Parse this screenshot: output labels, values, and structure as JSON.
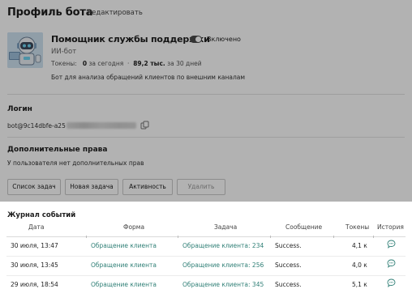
{
  "header": {
    "title": "Профиль бота",
    "edit_label": "Редактировать"
  },
  "bot": {
    "name": "Помощник службы поддержки",
    "toggle_label": "Включено",
    "type": "ИИ-бот",
    "tokens_label": "Токены:",
    "tokens_today_value": "0",
    "tokens_today_label": "за сегодня",
    "tokens_30_value": "89,2 тыс.",
    "tokens_30_label": "за 30 дней",
    "description": "Бот для анализа обращений клиентов по внешним каналам"
  },
  "login": {
    "title": "Логин",
    "value_prefix": "bot@9c14dbfe-a25"
  },
  "rights": {
    "title": "Дополнительные права",
    "text": "У пользователя нет дополнительных прав"
  },
  "actions": {
    "tasks_list": "Список задач",
    "new_task": "Новая задача",
    "activity": "Активность",
    "delete": "Удалить"
  },
  "journal": {
    "title": "Журнал событий",
    "columns": {
      "date": "Дата",
      "form": "Форма",
      "task": "Задача",
      "message": "Сообщение",
      "tokens": "Токены",
      "history": "История"
    },
    "rows": [
      {
        "date": "30 июля, 13:47",
        "form": "Обращение клиента",
        "task": "Обращение клиента: 234",
        "message": "Success.",
        "tokens": "4,1 к"
      },
      {
        "date": "30 июля, 13:45",
        "form": "Обращение клиента",
        "task": "Обращение клиента: 256",
        "message": "Success.",
        "tokens": "4,0 к"
      },
      {
        "date": "29 июля, 18:54",
        "form": "Обращение клиента",
        "task": "Обращение клиента: 345",
        "message": "Success.",
        "tokens": "5,1 к"
      }
    ]
  },
  "colors": {
    "link": "#2f7f76",
    "overlay": "rgba(0,0,0,0.30)"
  }
}
